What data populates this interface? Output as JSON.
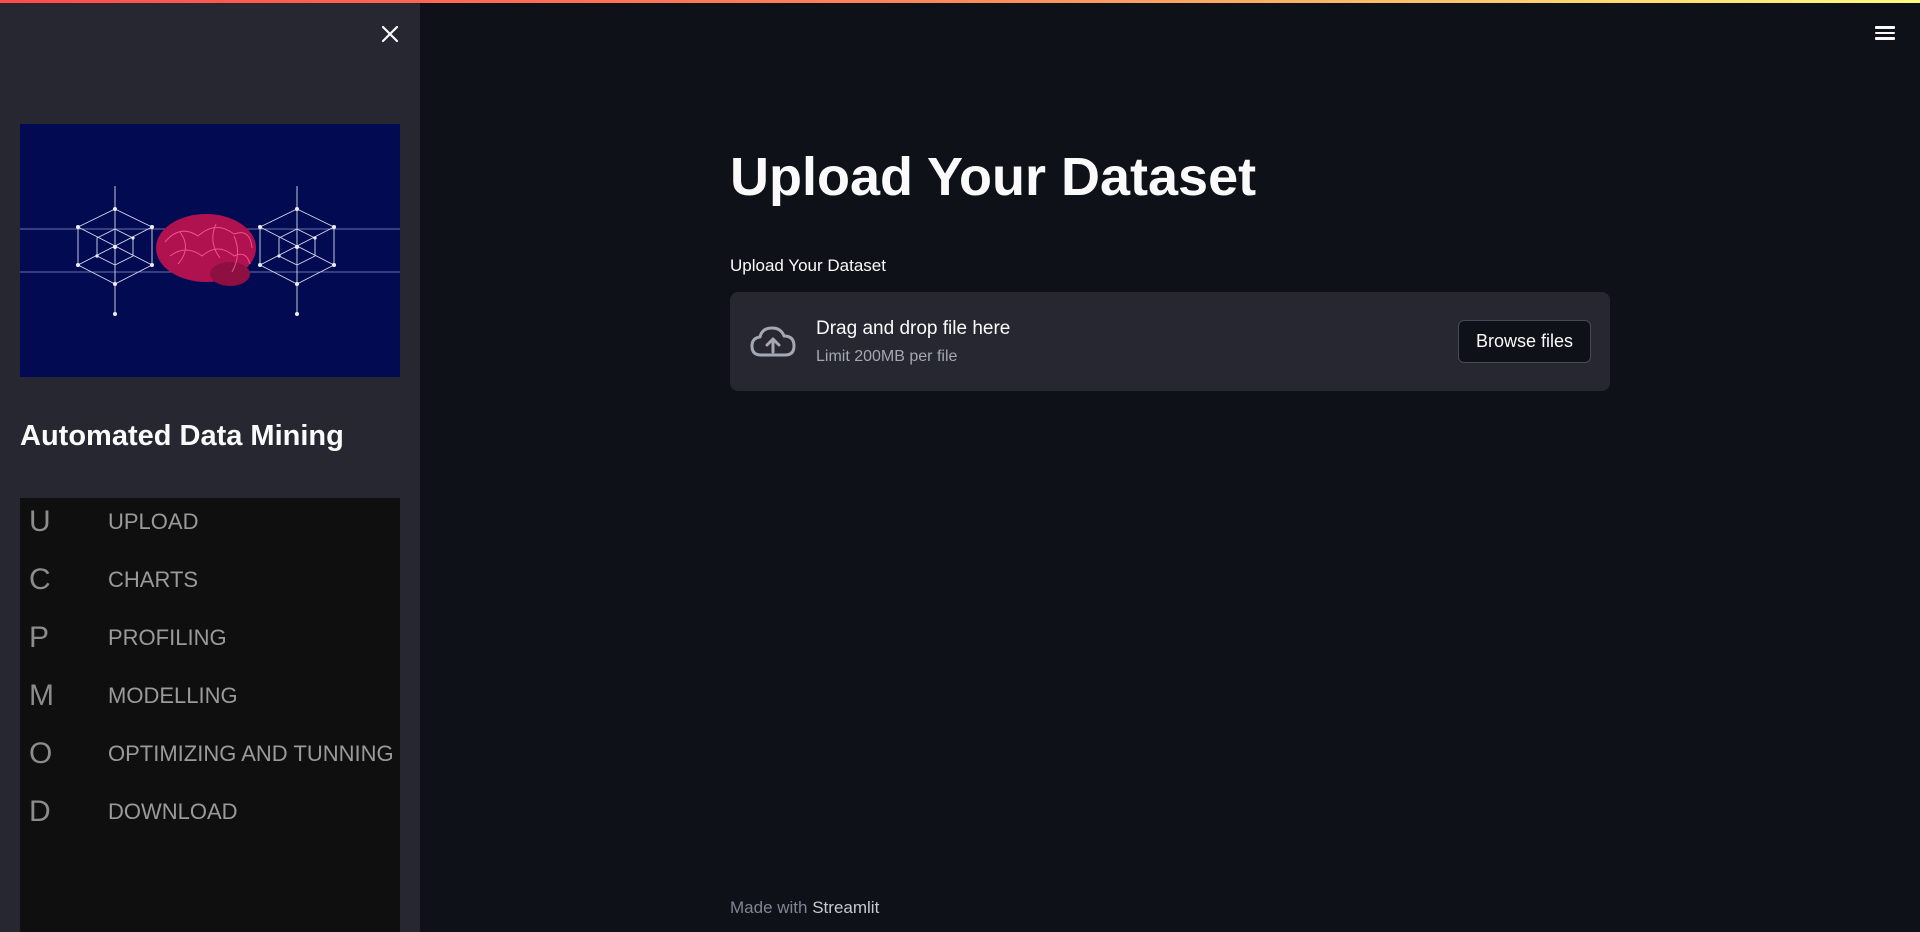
{
  "sidebar": {
    "title": "Automated Data Mining",
    "close_icon": "close-icon",
    "nav_items": [
      {
        "letter": "U",
        "label": "UPLOAD"
      },
      {
        "letter": "C",
        "label": "CHARTS"
      },
      {
        "letter": "P",
        "label": "PROFILING"
      },
      {
        "letter": "M",
        "label": "MODELLING"
      },
      {
        "letter": "O",
        "label": "OPTIMIZING AND TUNNING"
      },
      {
        "letter": "D",
        "label": "DOWNLOAD"
      }
    ]
  },
  "header": {
    "menu_icon": "hamburger-menu-icon"
  },
  "main": {
    "title": "Upload Your Dataset",
    "uploader": {
      "label": "Upload Your Dataset",
      "drop_text": "Drag and drop file here",
      "limit_text": "Limit 200MB per file",
      "browse_label": "Browse files",
      "icon": "cloud-upload-icon"
    }
  },
  "footer": {
    "prefix": "Made with",
    "link": "Streamlit"
  },
  "colors": {
    "background": "#0e1117",
    "sidebar": "#262730",
    "nav_background": "#0f0f0f",
    "image_background": "#020b52",
    "brain": "#c2185b"
  }
}
